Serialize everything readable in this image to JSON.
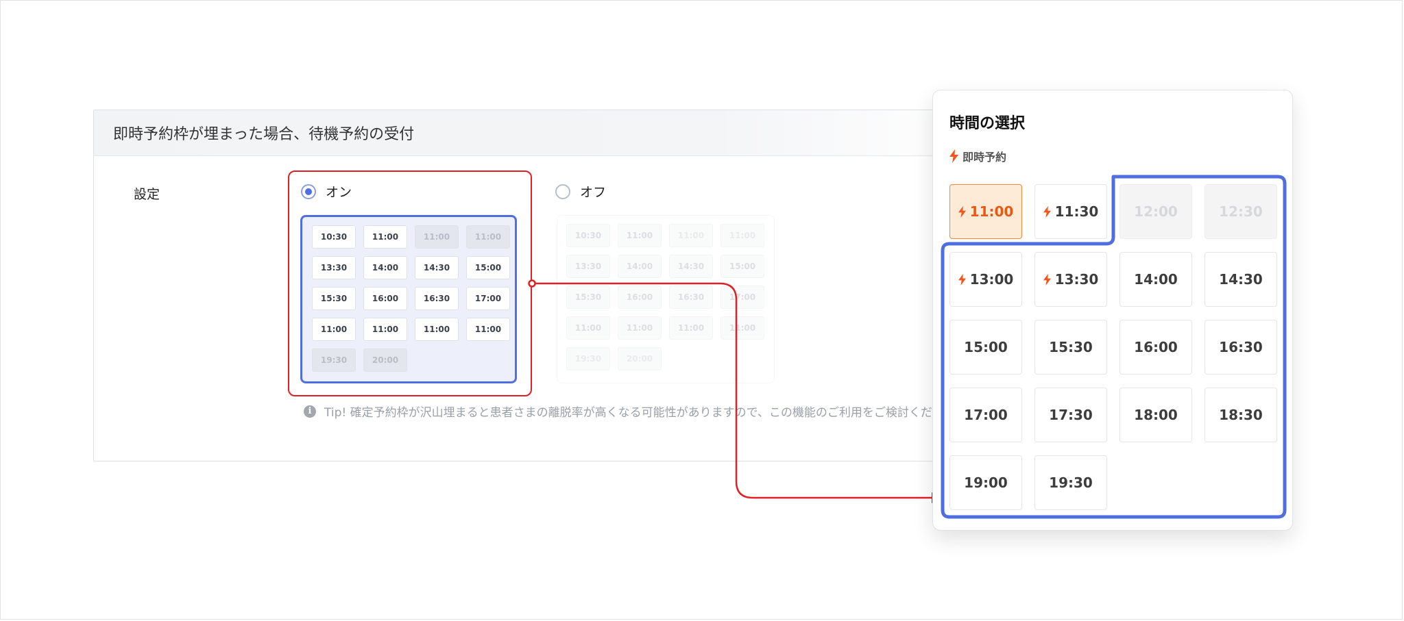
{
  "panel": {
    "title": "即時予約枠が埋まった場合、待機予約の受付",
    "setting_label": "設定",
    "on_label": "オン",
    "off_label": "オフ",
    "on_selected": true,
    "mini_slots": [
      {
        "time": "10:30",
        "disabled": false
      },
      {
        "time": "11:00",
        "disabled": false
      },
      {
        "time": "11:00",
        "disabled": true
      },
      {
        "time": "11:00",
        "disabled": true
      },
      {
        "time": "13:30",
        "disabled": false
      },
      {
        "time": "14:00",
        "disabled": false
      },
      {
        "time": "14:30",
        "disabled": false
      },
      {
        "time": "15:00",
        "disabled": false
      },
      {
        "time": "15:30",
        "disabled": false
      },
      {
        "time": "16:00",
        "disabled": false
      },
      {
        "time": "16:30",
        "disabled": false
      },
      {
        "time": "17:00",
        "disabled": false
      },
      {
        "time": "11:00",
        "disabled": false
      },
      {
        "time": "11:00",
        "disabled": false
      },
      {
        "time": "11:00",
        "disabled": false
      },
      {
        "time": "11:00",
        "disabled": false
      },
      {
        "time": "19:30",
        "disabled": true
      },
      {
        "time": "20:00",
        "disabled": true
      }
    ],
    "tip": "Tip! 確定予約枠が沢山埋まると患者さまの離脱率が高くなる可能性がありますので、この機能のご利用をご検討くだ"
  },
  "popup": {
    "title": "時間の選択",
    "instant_label": "即時予約",
    "slots": [
      {
        "time": "11:00",
        "instant": true,
        "state": "selected"
      },
      {
        "time": "11:30",
        "instant": true,
        "state": "available"
      },
      {
        "time": "12:00",
        "instant": false,
        "state": "disabled"
      },
      {
        "time": "12:30",
        "instant": false,
        "state": "disabled"
      },
      {
        "time": "13:00",
        "instant": true,
        "state": "available"
      },
      {
        "time": "13:30",
        "instant": true,
        "state": "available"
      },
      {
        "time": "14:00",
        "instant": false,
        "state": "available"
      },
      {
        "time": "14:30",
        "instant": false,
        "state": "available"
      },
      {
        "time": "15:00",
        "instant": false,
        "state": "available"
      },
      {
        "time": "15:30",
        "instant": false,
        "state": "available"
      },
      {
        "time": "16:00",
        "instant": false,
        "state": "available"
      },
      {
        "time": "16:30",
        "instant": false,
        "state": "available"
      },
      {
        "time": "17:00",
        "instant": false,
        "state": "available"
      },
      {
        "time": "17:30",
        "instant": false,
        "state": "available"
      },
      {
        "time": "18:00",
        "instant": false,
        "state": "available"
      },
      {
        "time": "18:30",
        "instant": false,
        "state": "available"
      },
      {
        "time": "19:00",
        "instant": false,
        "state": "available"
      },
      {
        "time": "19:30",
        "instant": false,
        "state": "available"
      }
    ]
  },
  "colors": {
    "accent_blue": "#4f6fe0",
    "highlight_red": "#e01f26",
    "instant_orange": "#f2561d"
  }
}
